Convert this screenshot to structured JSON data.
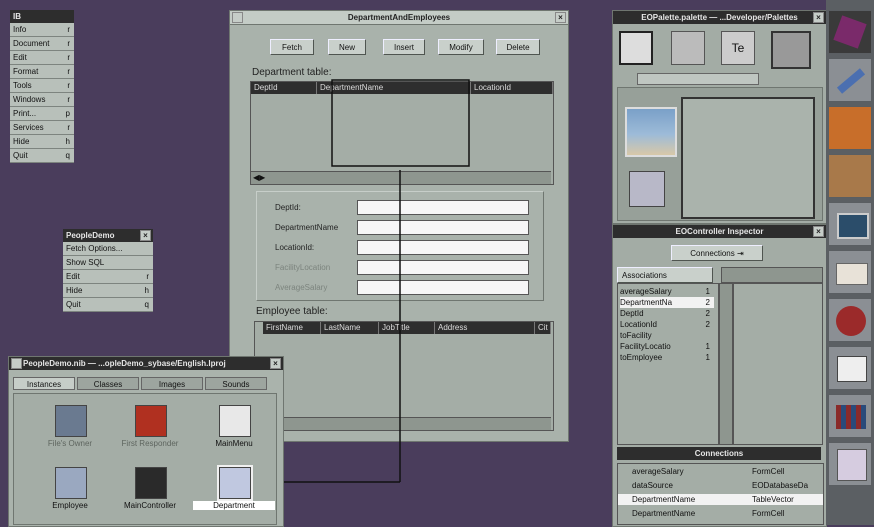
{
  "ib_menu": {
    "title": "IB",
    "items": [
      {
        "label": "Info",
        "key": "r"
      },
      {
        "label": "Document",
        "key": "r"
      },
      {
        "label": "Edit",
        "key": "r"
      },
      {
        "label": "Format",
        "key": "r"
      },
      {
        "label": "Tools",
        "key": "r"
      },
      {
        "label": "Windows",
        "key": "r"
      },
      {
        "label": "Print...",
        "key": "p"
      },
      {
        "label": "Services",
        "key": "r"
      },
      {
        "label": "Hide",
        "key": "h"
      },
      {
        "label": "Quit",
        "key": "q"
      }
    ]
  },
  "people_menu": {
    "title": "PeopleDemo",
    "items": [
      {
        "label": "Fetch Options...",
        "key": ""
      },
      {
        "label": "Show SQL",
        "key": ""
      },
      {
        "label": "Edit",
        "key": "r"
      },
      {
        "label": "Hide",
        "key": "h"
      },
      {
        "label": "Quit",
        "key": "q"
      }
    ]
  },
  "main_window": {
    "title": "DepartmentAndEmployees",
    "buttons": [
      "Fetch",
      "New",
      "Insert",
      "Modify",
      "Delete"
    ],
    "department_table_label": "Department table:",
    "department_columns": [
      "DeptId",
      "DepartmentName",
      "LocationId"
    ],
    "form_fields": [
      "DeptId:",
      "DepartmentName",
      "LocationId:",
      "FacilityLocation",
      "AverageSalary"
    ],
    "employee_table_label": "Employee table:",
    "employee_columns": [
      "FirstName",
      "LastName",
      "JobTitle",
      "Address",
      "Cit"
    ]
  },
  "nib_window": {
    "title": "PeopleDemo.nib — ...opleDemo_sybase/English.lproj",
    "tabs": [
      "Instances",
      "Classes",
      "Images",
      "Sounds"
    ],
    "icons": [
      "File's Owner",
      "First Responder",
      "MainMenu",
      "Employee",
      "MainController",
      "Department"
    ]
  },
  "palette_window": {
    "title": "EOPalette.palette — ...Developer/Palettes"
  },
  "inspector": {
    "title": "EOController Inspector",
    "mode": "Connections",
    "associations_label": "Associations",
    "keys": [
      {
        "name": "averageSalary",
        "count": "1"
      },
      {
        "name": "DepartmentNa",
        "count": "2"
      },
      {
        "name": "DeptId",
        "count": "2"
      },
      {
        "name": "LocationId",
        "count": "2"
      },
      {
        "name": "toFacility",
        "count": ""
      },
      {
        "name": "FacilityLocatio",
        "count": "1"
      },
      {
        "name": "toEmployee",
        "count": "1"
      }
    ],
    "connections_header": "Connections",
    "connections": [
      {
        "outlet": "averageSalary",
        "target": "FormCell"
      },
      {
        "outlet": "dataSource",
        "target": "EODatabaseDa"
      },
      {
        "outlet": "DepartmentName",
        "target": "TableVector"
      },
      {
        "outlet": "DepartmentName",
        "target": "FormCell"
      }
    ]
  }
}
